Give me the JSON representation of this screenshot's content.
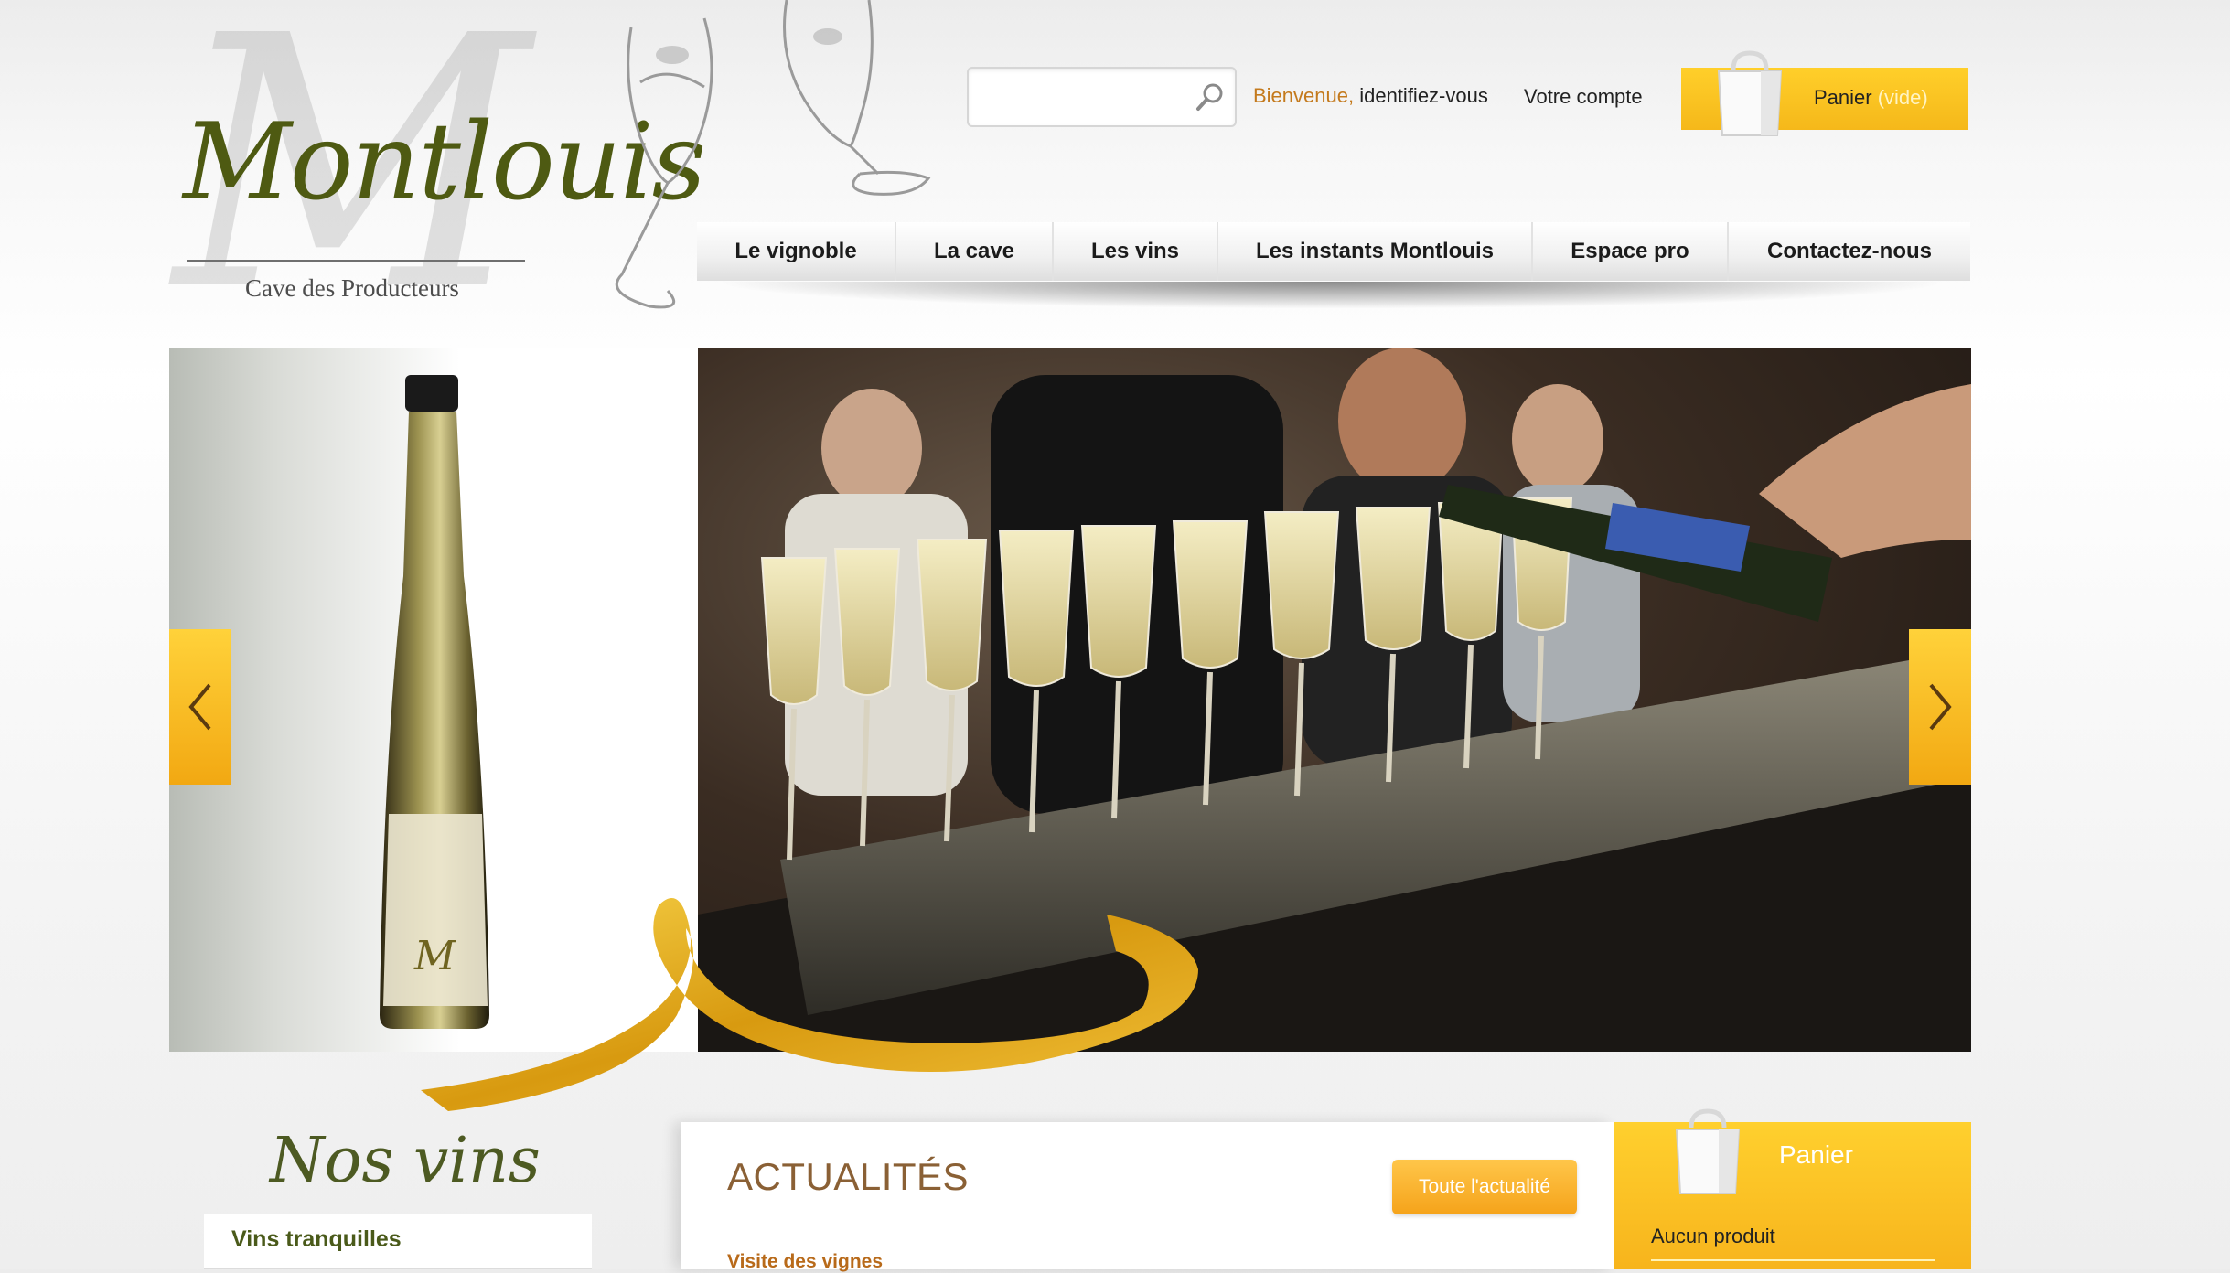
{
  "logo": {
    "monogram": "M",
    "brand": "Montlouis",
    "tagline": "Cave des Producteurs"
  },
  "search": {
    "placeholder": "",
    "icon": "search-icon"
  },
  "header": {
    "welcome_highlight": "Bienvenue,",
    "welcome_link": "identifiez-vous",
    "account": "Votre compte",
    "cart_label": "Panier",
    "cart_status": "(vide)"
  },
  "nav": {
    "items": [
      {
        "label": "Le vignoble"
      },
      {
        "label": "La cave"
      },
      {
        "label": "Les vins"
      },
      {
        "label": "Les instants Montlouis"
      },
      {
        "label": "Espace pro"
      },
      {
        "label": "Contactez-nous"
      }
    ]
  },
  "slider": {
    "prev_icon": "chevron-left-icon",
    "next_icon": "chevron-right-icon"
  },
  "sections": {
    "nos_vins_title": "Nos vins",
    "vins_tranquilles": "Vins tranquilles",
    "news_title": "ACTUALITÉS",
    "news_button": "Toute l'actualité",
    "news_item": "Visite des vignes",
    "cart_title": "Panier",
    "cart_empty": "Aucun produit"
  },
  "colors": {
    "accent": "#f5b81a",
    "olive": "#4e5a12",
    "brown": "#8a6035",
    "orange_text": "#c47a1d"
  }
}
